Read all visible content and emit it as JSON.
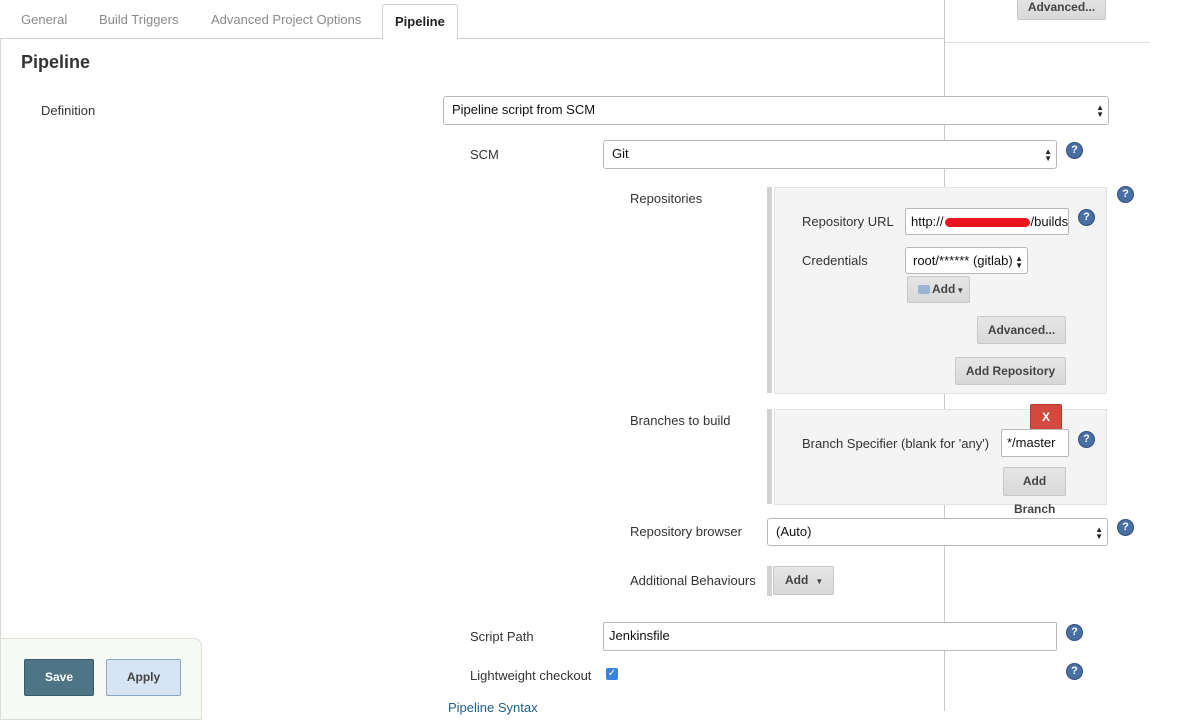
{
  "tabs": [
    {
      "label": "General"
    },
    {
      "label": "Build Triggers"
    },
    {
      "label": "Advanced Project Options"
    },
    {
      "label": "Pipeline"
    }
  ],
  "top_right_advanced": "Advanced...",
  "section_title": "Pipeline",
  "definition": {
    "label": "Definition",
    "value": "Pipeline script from SCM"
  },
  "scm": {
    "label": "SCM",
    "value": "Git"
  },
  "repositories": {
    "label": "Repositories",
    "url_label": "Repository URL",
    "url_prefix": "http://",
    "url_suffix": "/builds",
    "credentials_label": "Credentials",
    "credentials_value": "root/****** (gitlab)",
    "add_label": "Add",
    "advanced_label": "Advanced...",
    "add_repository_label": "Add Repository"
  },
  "branches": {
    "label": "Branches to build",
    "delete_label": "X",
    "specifier_label": "Branch Specifier (blank for 'any')",
    "specifier_value": "*/master",
    "add_label": "Add",
    "branch_label": "Branch"
  },
  "repo_browser": {
    "label": "Repository browser",
    "value": "(Auto)"
  },
  "additional": {
    "label": "Additional Behaviours",
    "add_label": "Add"
  },
  "script_path": {
    "label": "Script Path",
    "value": "Jenkinsfile"
  },
  "lightweight": {
    "label": "Lightweight checkout",
    "checked": true
  },
  "pipeline_syntax": "Pipeline Syntax",
  "footer": {
    "save": "Save",
    "apply": "Apply"
  },
  "colors": {
    "save_bg": "#4e7585",
    "apply_bg": "#d6e4f3",
    "help_icon": "#4a6fa5",
    "delete_red": "#d24a3d"
  }
}
